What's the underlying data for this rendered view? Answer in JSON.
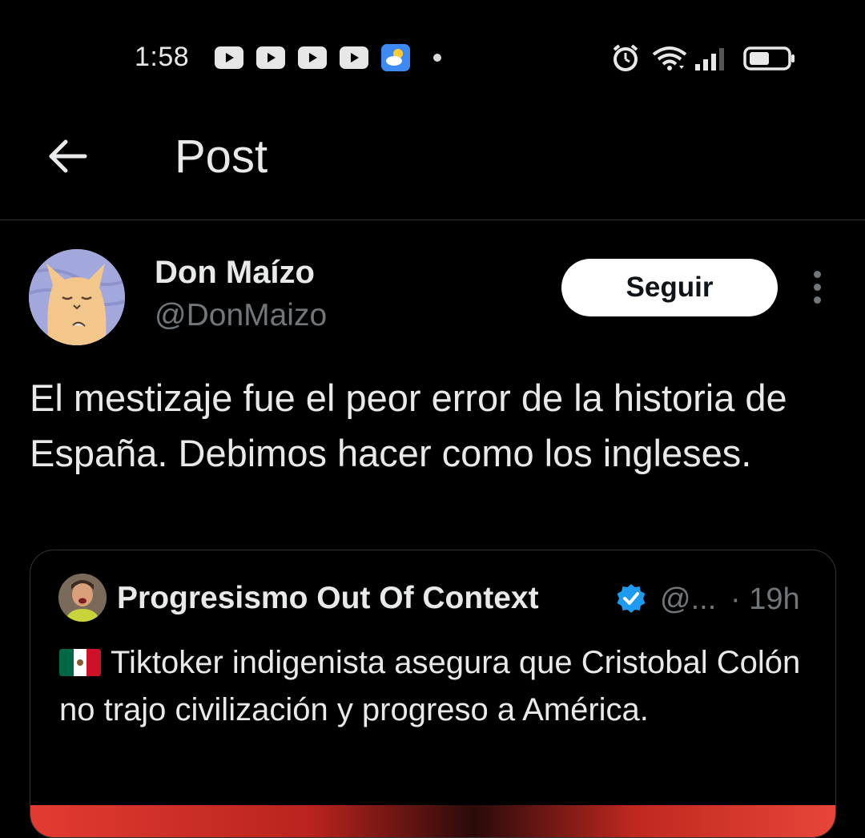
{
  "status_bar": {
    "time": "1:58",
    "icons": [
      "youtube-icon",
      "youtube-icon",
      "youtube-icon",
      "youtube-icon",
      "weather-icon",
      "notification-dot",
      "alarm-icon",
      "wifi-icon",
      "signal-icon",
      "battery-icon"
    ]
  },
  "header": {
    "back_icon": "back-arrow-icon",
    "title": "Post"
  },
  "post": {
    "author_name": "Don Maízo",
    "author_handle": "@DonMaizo",
    "follow_label": "Seguir",
    "more_icon": "more-vertical-icon",
    "text": "El mestizaje fue el peor error de la historia de España. Debimos hacer como los ingleses."
  },
  "quote": {
    "name": "Progresismo Out Of Context",
    "verified_icon": "verified-badge-icon",
    "handle": "@...",
    "time": "· 19h",
    "flag_icon": "mexico-flag-icon",
    "text": "Tiktoker indigenista asegura que Cristobal Colón no trajo civilización y progreso a América."
  },
  "colors": {
    "background": "#000000",
    "text": "#e7e9ea",
    "secondary_text": "#71767b",
    "verified": "#1d9bf0",
    "divider": "#2f3336"
  }
}
